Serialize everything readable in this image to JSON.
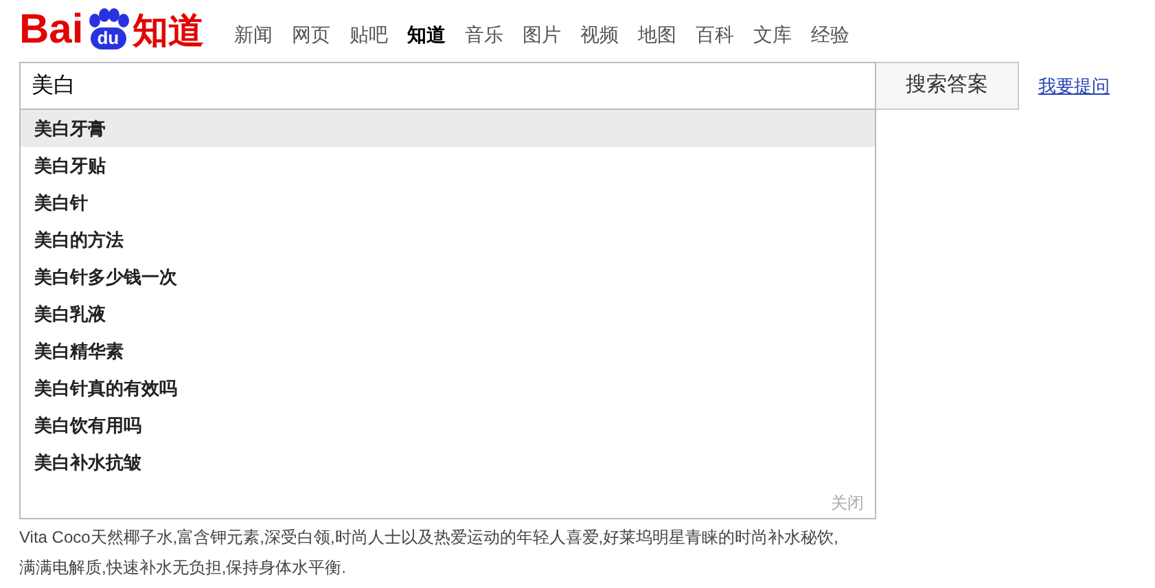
{
  "logo": {
    "part_1": "Bai",
    "part_2": "du",
    "part_3": "知道"
  },
  "nav": [
    {
      "label": "新闻",
      "selected": false
    },
    {
      "label": "网页",
      "selected": false
    },
    {
      "label": "贴吧",
      "selected": false
    },
    {
      "label": "知道",
      "selected": true
    },
    {
      "label": "音乐",
      "selected": false
    },
    {
      "label": "图片",
      "selected": false
    },
    {
      "label": "视频",
      "selected": false
    },
    {
      "label": "地图",
      "selected": false
    },
    {
      "label": "百科",
      "selected": false
    },
    {
      "label": "文库",
      "selected": false
    },
    {
      "label": "经验",
      "selected": false
    }
  ],
  "search": {
    "value": "美白",
    "button": "搜索答案",
    "ask_link": "我要提问"
  },
  "suggestions": [
    {
      "text": "美白牙膏",
      "selected": true
    },
    {
      "text": "美白牙贴",
      "selected": false
    },
    {
      "text": "美白针",
      "selected": false
    },
    {
      "text": "美白的方法",
      "selected": false
    },
    {
      "text": "美白针多少钱一次",
      "selected": false
    },
    {
      "text": "美白乳液",
      "selected": false
    },
    {
      "text": "美白精华素",
      "selected": false
    },
    {
      "text": "美白针真的有效吗",
      "selected": false
    },
    {
      "text": "美白饮有用吗",
      "selected": false
    },
    {
      "text": "美白补水抗皱",
      "selected": false
    }
  ],
  "close_label": "关闭",
  "description": "Vita Coco天然椰子水,富含钾元素,深受白领,时尚人士以及热爱运动的年轻人喜爱,好莱坞明星青睐的时尚补水秘饮,满满电解质,快速补水无负担,保持身体水平衡."
}
